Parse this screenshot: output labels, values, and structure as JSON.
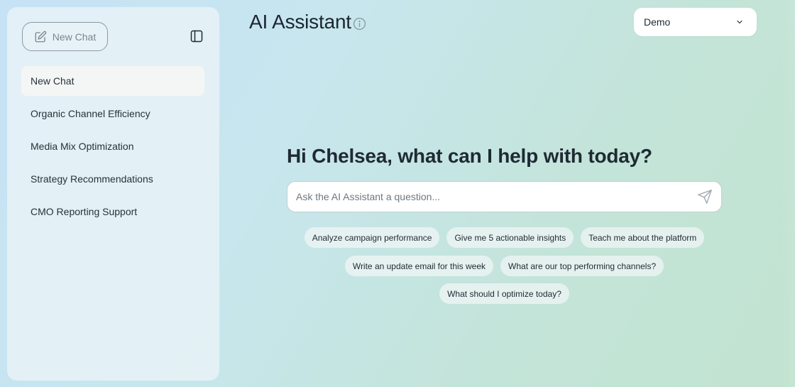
{
  "sidebar": {
    "new_chat_label": "New Chat",
    "items": [
      {
        "label": "New Chat",
        "active": true
      },
      {
        "label": "Organic Channel Efficiency"
      },
      {
        "label": "Media Mix Optimization"
      },
      {
        "label": "Strategy Recommendations"
      },
      {
        "label": "CMO Reporting Support"
      }
    ]
  },
  "header": {
    "title": "AI Assistant",
    "dropdown_value": "Demo"
  },
  "main": {
    "greeting": "Hi Chelsea, what can I help with today?",
    "input_placeholder": "Ask the AI Assistant a question...",
    "suggestions": [
      "Analyze campaign performance",
      "Give me 5 actionable insights",
      "Teach me about the platform",
      "Write an update email for this week",
      "What are our top performing channels?",
      "What should I optimize today?"
    ]
  },
  "icons": {
    "new_chat": "edit-icon",
    "collapse": "sidebar-toggle-icon",
    "info": "info-icon",
    "dropdown": "chevron-down-icon",
    "send": "send-icon"
  }
}
